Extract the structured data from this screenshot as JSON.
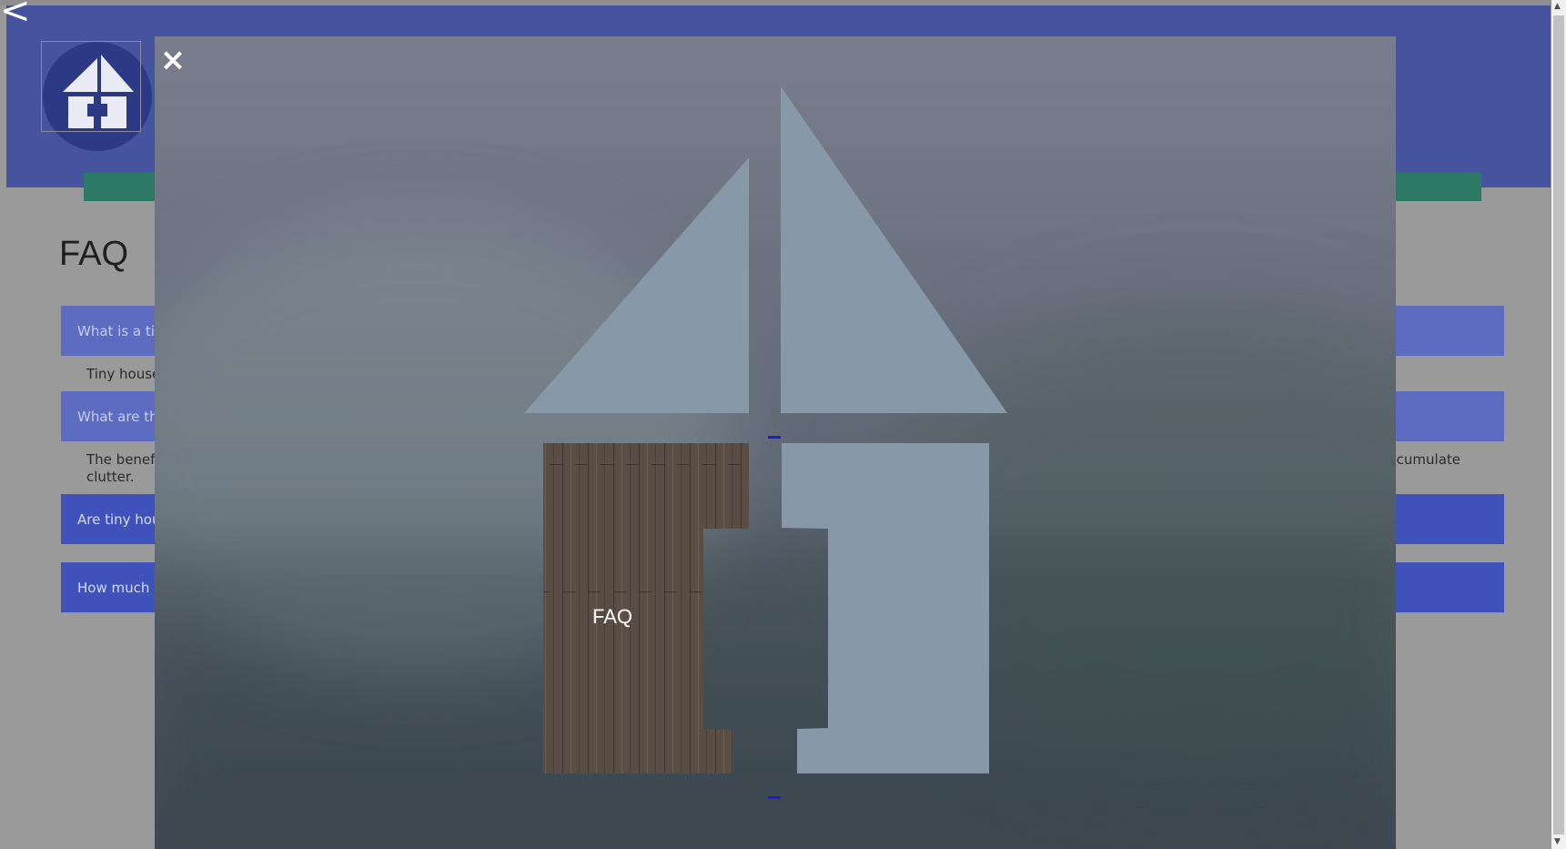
{
  "nav": {
    "back_glyph": "<"
  },
  "faq": {
    "title": "FAQ",
    "items": [
      {
        "question": "What is a ti",
        "answer": "Tiny house"
      },
      {
        "question": "What are th",
        "answer": "The benefi",
        "answer_cont": "clutter.",
        "answer_right": "accumulate"
      },
      {
        "question": "Are tiny hou"
      },
      {
        "question": "How much c"
      }
    ]
  },
  "modal": {
    "close_glyph": "×",
    "tile_label": "FAQ"
  },
  "icons": [
    "home-logo-icon",
    "close-icon",
    "back-arrow-icon"
  ],
  "colors": {
    "header": "#4654a0",
    "nav": "#2c7a66",
    "faq_question": "#3f52bc",
    "house_panel": "#8798a8"
  }
}
